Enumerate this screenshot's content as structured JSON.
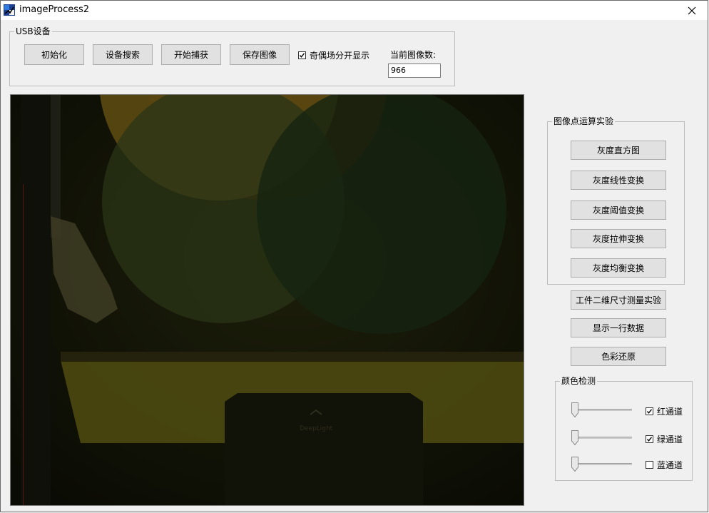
{
  "window": {
    "title": "imageProcess2"
  },
  "usb_group": {
    "title": "USB设备",
    "buttons": [
      "初始化",
      "设备搜索",
      "开始捕获",
      "保存图像"
    ],
    "field_toggle": {
      "label": "奇偶场分开显示",
      "checked": true
    },
    "image_count": {
      "label": "当前图像数:",
      "value": "966"
    }
  },
  "point_ops_group": {
    "title": "图像点运算实验",
    "buttons": [
      "灰度直方图",
      "灰度线性变换",
      "灰度阈值变换",
      "灰度拉伸变换",
      "灰度均衡变换"
    ]
  },
  "extra_buttons": [
    "工件二维尺寸测量实验",
    "显示一行数据",
    "色彩还原"
  ],
  "color_detect_group": {
    "title": "颜色检测",
    "channels": [
      {
        "label": "红通道",
        "checked": true,
        "level": 0
      },
      {
        "label": "绿通道",
        "checked": true,
        "level": 0
      },
      {
        "label": "蓝通道",
        "checked": false,
        "level": 0
      }
    ]
  },
  "image_view": {
    "logo_text": "DeepLight"
  },
  "icons": {
    "app": "app-icon",
    "close": "close-icon",
    "check": "check-icon",
    "slider": "slider-thumb"
  }
}
